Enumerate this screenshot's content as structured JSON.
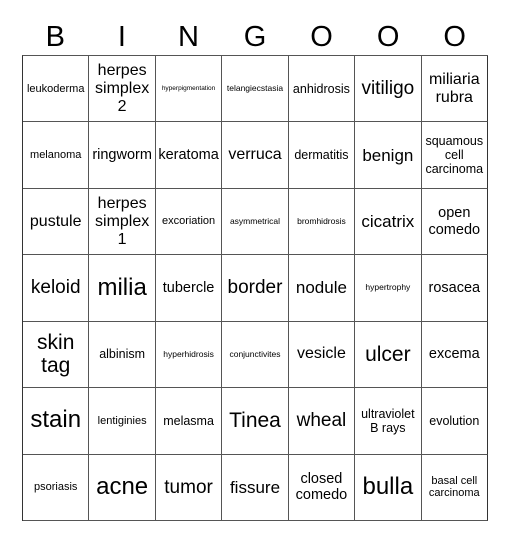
{
  "header": [
    "B",
    "I",
    "N",
    "G",
    "O",
    "O",
    "O"
  ],
  "rows": [
    [
      "leukoderma",
      "herpes simplex 2",
      "hyperpigmentation",
      "telangiecstasia",
      "anhidrosis",
      "vitiligo",
      "miliaria rubra"
    ],
    [
      "melanoma",
      "ringworm",
      "keratoma",
      "verruca",
      "dermatitis",
      "benign",
      "squamous cell carcinoma"
    ],
    [
      "pustule",
      "herpes simplex 1",
      "excoriation",
      "asymmetrical",
      "bromhidrosis",
      "cicatrix",
      "open comedo"
    ],
    [
      "keloid",
      "milia",
      "tubercle",
      "border",
      "nodule",
      "hypertrophy",
      "rosacea"
    ],
    [
      "skin tag",
      "albinism",
      "hyperhidrosis",
      "conjunctivites",
      "vesicle",
      "ulcer",
      "excema"
    ],
    [
      "stain",
      "lentiginies",
      "melasma",
      "Tinea",
      "wheal",
      "ultraviolet B rays",
      "evolution"
    ],
    [
      "psoriasis",
      "acne",
      "tumor",
      "fissure",
      "closed comedo",
      "bulla",
      "basal cell carcinoma"
    ]
  ]
}
